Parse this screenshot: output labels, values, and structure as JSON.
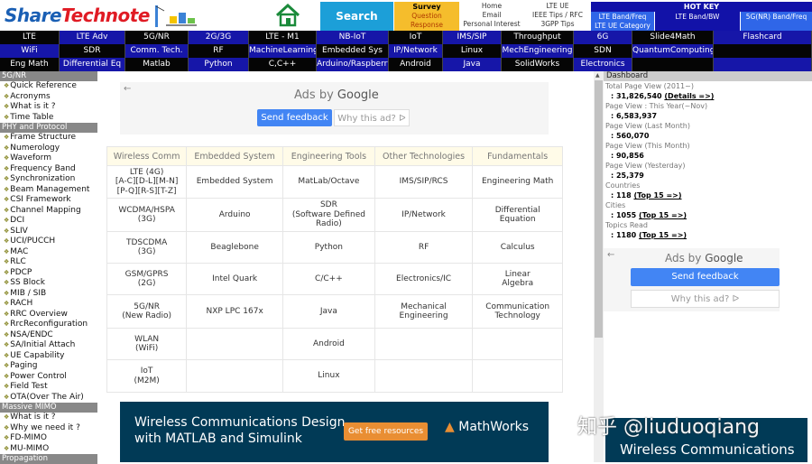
{
  "header": {
    "logo_part1": "Share",
    "logo_part2": "Technote",
    "search_label": "Search",
    "survey": {
      "title": "Survey",
      "line1": "Question",
      "line2": "Response"
    },
    "links": [
      "Home",
      "Email",
      "Personal Interest"
    ],
    "tips": [
      "LTE UE",
      "IEEE Tips / RFC",
      "3GPP Tips"
    ],
    "hotkey": {
      "title": "HOT KEY",
      "items": [
        "LTE Band/Freq",
        "LTE UE Category",
        "LTE Band/BW",
        "5G(NR) Band/Freq"
      ]
    }
  },
  "nav": {
    "row1": [
      "LTE",
      "LTE Adv",
      "5G/NR",
      "2G/3G",
      "LTE - M1",
      "NB-IoT",
      "IoT",
      "IMS/SIP",
      "Throughput",
      "6G",
      "Slide4Math",
      "Flashcard"
    ],
    "row2": [
      "WiFi",
      "SDR",
      "Comm. Tech.",
      "RF",
      "MachineLearning",
      "Embedded Sys",
      "IP/Network",
      "Linux",
      "MechEngineering",
      "SDN",
      "QuantumComputing",
      ""
    ],
    "row3": [
      "Eng Math",
      "Differential Eq",
      "Matlab",
      "Python",
      "C,C++",
      "Arduino/Raspberry",
      "Android",
      "Java",
      "SolidWorks",
      "Electronics",
      "",
      ""
    ]
  },
  "sidebar": {
    "sections": [
      {
        "title": "5G/NR",
        "items": [
          "Quick Reference",
          "Acronyms",
          "What is it ?",
          "Time Table"
        ]
      },
      {
        "title": "PHY and Protocol",
        "items": [
          "Frame Structure",
          "Numerology",
          "Waveform",
          "Frequency Band",
          "Synchronization",
          "Beam Management",
          "CSI Framework",
          "Channel Mapping",
          "DCI",
          "SLIV",
          "UCI/PUCCH",
          "MAC",
          "RLC",
          "PDCP",
          "SS Block",
          "MIB / SIB",
          "RACH",
          "RRC Overview",
          "RrcReconfiguration",
          "NSA/ENDC",
          "SA/Initial Attach",
          "UE Capability",
          "Paging",
          "Power Control",
          "Field Test",
          "OTA(Over The Air)"
        ]
      },
      {
        "title": "Massive MIMO",
        "items": [
          "What is it ?",
          "Why we need it ?",
          "FD-MIMO",
          "MU-MIMO"
        ]
      },
      {
        "title": "Propagation",
        "items": []
      }
    ]
  },
  "ads": {
    "ads_by": "Ads by",
    "google": "Google",
    "send_feedback": "Send feedback",
    "why_ad": "Why this ad? ᐅ"
  },
  "topics": {
    "headers": [
      "Wireless Comm",
      "Embedded System",
      "Engineering Tools",
      "Other Technologies",
      "Fundamentals"
    ],
    "rows": [
      [
        "LTE (4G)\n[A-C][D-L][M-N]\n[P-Q][R-S][T-Z]",
        "Embedded System",
        "MatLab/Octave",
        "IMS/SIP/RCS",
        "Engineering Math"
      ],
      [
        "WCDMA/HSPA\n(3G)",
        "Arduino",
        "SDR\n(Software Defined\nRadio)",
        "IP/Network",
        "Differential\nEquation"
      ],
      [
        "TDSCDMA\n(3G)",
        "Beaglebone",
        "Python",
        "RF",
        "Calculus"
      ],
      [
        "GSM/GPRS\n(2G)",
        "Intel Quark",
        "C/C++",
        "Electronics/IC",
        "Linear\nAlgebra"
      ],
      [
        "5G/NR\n(New Radio)",
        "NXP LPC 167x",
        "Java",
        "Mechanical\nEngineering",
        "Communication\nTechnology"
      ],
      [
        "WLAN\n(WiFi)",
        "",
        "Android",
        "",
        ""
      ],
      [
        "IoT\n(M2M)",
        "",
        "Linux",
        "",
        ""
      ]
    ]
  },
  "banner": {
    "line1": "Wireless Communications Design",
    "line2": "with MATLAB and Simulink",
    "button": "Get free resources",
    "brand": "MathWorks"
  },
  "dashboard": {
    "title": "Dashboard",
    "stats": [
      {
        "label": "Total Page View (2011~)",
        "value": "31,826,540",
        "link": "(Details =>)"
      },
      {
        "label": "Page View  : This Year(~Nov)",
        "value": "6,583,937",
        "link": ""
      },
      {
        "label": "Page View (Last Month)",
        "value": "560,070",
        "link": ""
      },
      {
        "label": "Page View (This Month)",
        "value": "90,856",
        "link": ""
      },
      {
        "label": "Page View (Yesterday)",
        "value": "25,379",
        "link": ""
      },
      {
        "label": "Countries",
        "value": "118",
        "link": "(Top 15 =>)"
      },
      {
        "label": "Cities",
        "value": "1055",
        "link": "(Top 15 =>)"
      },
      {
        "label": "Topics Read",
        "value": "1180",
        "link": "(Top 15 =>)"
      }
    ],
    "banner_text": "Wireless Communications"
  },
  "watermark": "知乎 @liuduoqiang",
  "colors": {
    "nav_blue": "#1616a8",
    "search": "#1c9fd8",
    "survey": "#f5bd2c",
    "ad_blue": "#4285f4",
    "banner": "#013a56"
  }
}
